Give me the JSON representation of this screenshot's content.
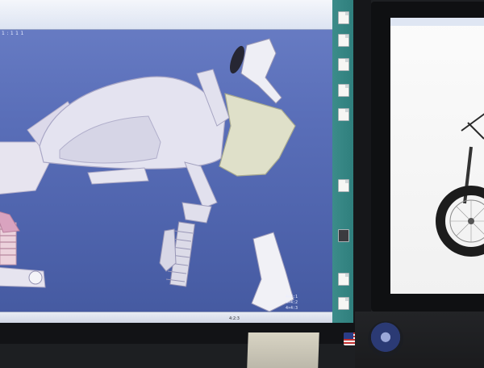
{
  "scene": {
    "description_tag": "office-desk-with-two-monitors"
  },
  "left_monitor": {
    "cad_app": {
      "viewport_readout": "1 : 1 1 1",
      "status_readout": "4:2:3",
      "status_values": [
        "4×4:1",
        "4×4:2",
        "4×4:3"
      ]
    },
    "desktop_icons": [
      {
        "icon": "document-icon",
        "label": ""
      },
      {
        "icon": "document-icon",
        "label": ""
      },
      {
        "icon": "document-icon",
        "label": ""
      },
      {
        "icon": "document-icon",
        "label": ""
      },
      {
        "icon": "document-icon",
        "label": ""
      },
      {
        "icon": "document-icon",
        "label": ""
      },
      {
        "icon": "document-icon",
        "label": ""
      },
      {
        "icon": "document-icon",
        "label": ""
      }
    ]
  },
  "right_monitor": {
    "content": "motorcycle-photo"
  },
  "colors": {
    "cad_background": "#5a6fb9",
    "part_white": "#e8e8f2",
    "part_tank": "#d9dccb",
    "taskbar": "#2f7f7d"
  }
}
